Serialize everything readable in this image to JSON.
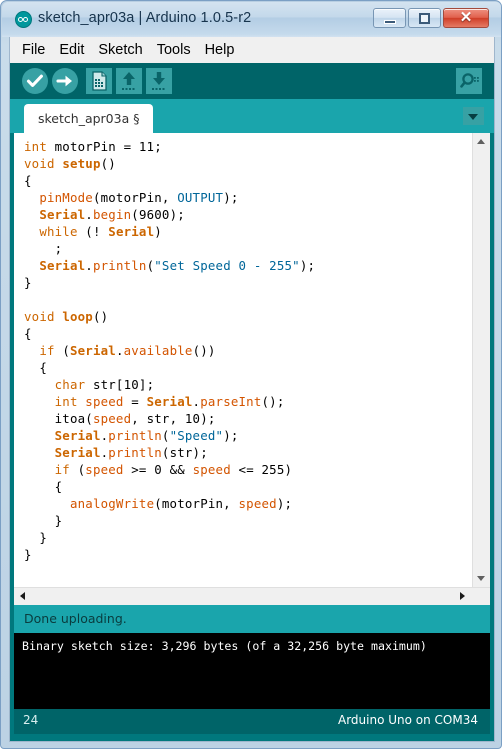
{
  "window": {
    "title": "sketch_apr03a | Arduino 1.0.5-r2",
    "logo_icon": "arduino-infinity-icon",
    "minimize_icon": "minimize-icon",
    "maximize_icon": "maximize-icon",
    "close_icon": "close-icon",
    "close_glyph": "✕"
  },
  "menu": {
    "items": [
      {
        "label": "File"
      },
      {
        "label": "Edit"
      },
      {
        "label": "Sketch"
      },
      {
        "label": "Tools"
      },
      {
        "label": "Help"
      }
    ]
  },
  "toolbar": {
    "verify": {
      "name": "verify-button",
      "icon": "checkmark-icon",
      "tooltip": "Verify"
    },
    "upload": {
      "name": "upload-button",
      "icon": "arrow-right-icon",
      "tooltip": "Upload"
    },
    "new": {
      "name": "new-button",
      "icon": "new-document-icon",
      "tooltip": "New"
    },
    "open": {
      "name": "open-button",
      "icon": "arrow-up-icon",
      "tooltip": "Open"
    },
    "save": {
      "name": "save-button",
      "icon": "arrow-down-icon",
      "tooltip": "Save"
    },
    "serial_monitor": {
      "name": "serial-monitor-button",
      "icon": "magnifier-icon",
      "tooltip": "Serial Monitor"
    }
  },
  "tabs": {
    "active": "sketch_apr03a §",
    "menu_icon": "chevron-down-icon"
  },
  "editor": {
    "code_lines": [
      [
        {
          "t": "int ",
          "c": "kw"
        },
        {
          "t": "motorPin = 11;",
          "c": "pl"
        }
      ],
      [
        {
          "t": "void ",
          "c": "kw"
        },
        {
          "t": "setup",
          "c": "bd"
        },
        {
          "t": "()",
          "c": "pl"
        }
      ],
      [
        {
          "t": "{",
          "c": "pl"
        }
      ],
      [
        {
          "t": "  ",
          "c": "pl"
        },
        {
          "t": "pinMode",
          "c": "fn"
        },
        {
          "t": "(motorPin, ",
          "c": "pl"
        },
        {
          "t": "OUTPUT",
          "c": "lit"
        },
        {
          "t": ");",
          "c": "pl"
        }
      ],
      [
        {
          "t": "  ",
          "c": "pl"
        },
        {
          "t": "Serial",
          "c": "bd"
        },
        {
          "t": ".",
          "c": "pl"
        },
        {
          "t": "begin",
          "c": "fn"
        },
        {
          "t": "(9600);",
          "c": "pl"
        }
      ],
      [
        {
          "t": "  ",
          "c": "pl"
        },
        {
          "t": "while",
          "c": "kw"
        },
        {
          "t": " (! ",
          "c": "pl"
        },
        {
          "t": "Serial",
          "c": "bd"
        },
        {
          "t": ")",
          "c": "pl"
        }
      ],
      [
        {
          "t": "    ;",
          "c": "pl"
        }
      ],
      [
        {
          "t": "  ",
          "c": "pl"
        },
        {
          "t": "Serial",
          "c": "bd"
        },
        {
          "t": ".",
          "c": "pl"
        },
        {
          "t": "println",
          "c": "fn"
        },
        {
          "t": "(",
          "c": "pl"
        },
        {
          "t": "\"Set Speed 0 - 255\"",
          "c": "lit"
        },
        {
          "t": ");",
          "c": "pl"
        }
      ],
      [
        {
          "t": "}",
          "c": "pl"
        }
      ],
      [
        {
          "t": "",
          "c": "pl"
        }
      ],
      [
        {
          "t": "void ",
          "c": "kw"
        },
        {
          "t": "loop",
          "c": "bd"
        },
        {
          "t": "()",
          "c": "pl"
        }
      ],
      [
        {
          "t": "{",
          "c": "pl"
        }
      ],
      [
        {
          "t": "  ",
          "c": "pl"
        },
        {
          "t": "if",
          "c": "kw"
        },
        {
          "t": " (",
          "c": "pl"
        },
        {
          "t": "Serial",
          "c": "bd"
        },
        {
          "t": ".",
          "c": "pl"
        },
        {
          "t": "available",
          "c": "fn"
        },
        {
          "t": "())",
          "c": "pl"
        }
      ],
      [
        {
          "t": "  {",
          "c": "pl"
        }
      ],
      [
        {
          "t": "    ",
          "c": "pl"
        },
        {
          "t": "char ",
          "c": "kw"
        },
        {
          "t": "str[10];",
          "c": "pl"
        }
      ],
      [
        {
          "t": "    ",
          "c": "pl"
        },
        {
          "t": "int ",
          "c": "kw"
        },
        {
          "t": "speed",
          "c": "fn"
        },
        {
          "t": " = ",
          "c": "pl"
        },
        {
          "t": "Serial",
          "c": "bd"
        },
        {
          "t": ".",
          "c": "pl"
        },
        {
          "t": "parseInt",
          "c": "fn"
        },
        {
          "t": "();",
          "c": "pl"
        }
      ],
      [
        {
          "t": "    itoa(",
          "c": "pl"
        },
        {
          "t": "speed",
          "c": "fn"
        },
        {
          "t": ", str, 10);",
          "c": "pl"
        }
      ],
      [
        {
          "t": "    ",
          "c": "pl"
        },
        {
          "t": "Serial",
          "c": "bd"
        },
        {
          "t": ".",
          "c": "pl"
        },
        {
          "t": "println",
          "c": "fn"
        },
        {
          "t": "(",
          "c": "pl"
        },
        {
          "t": "\"Speed\"",
          "c": "lit"
        },
        {
          "t": ");",
          "c": "pl"
        }
      ],
      [
        {
          "t": "    ",
          "c": "pl"
        },
        {
          "t": "Serial",
          "c": "bd"
        },
        {
          "t": ".",
          "c": "pl"
        },
        {
          "t": "println",
          "c": "fn"
        },
        {
          "t": "(str);",
          "c": "pl"
        }
      ],
      [
        {
          "t": "    ",
          "c": "pl"
        },
        {
          "t": "if",
          "c": "kw"
        },
        {
          "t": " (",
          "c": "pl"
        },
        {
          "t": "speed",
          "c": "fn"
        },
        {
          "t": " >= 0 && ",
          "c": "pl"
        },
        {
          "t": "speed",
          "c": "fn"
        },
        {
          "t": " <= 255)",
          "c": "pl"
        }
      ],
      [
        {
          "t": "    {",
          "c": "pl"
        }
      ],
      [
        {
          "t": "      ",
          "c": "pl"
        },
        {
          "t": "analogWrite",
          "c": "fn"
        },
        {
          "t": "(motorPin, ",
          "c": "pl"
        },
        {
          "t": "speed",
          "c": "fn"
        },
        {
          "t": ");",
          "c": "pl"
        }
      ],
      [
        {
          "t": "    }",
          "c": "pl"
        }
      ],
      [
        {
          "t": "  }",
          "c": "pl"
        }
      ],
      [
        {
          "t": "}",
          "c": "pl"
        }
      ]
    ]
  },
  "scrollbars": {
    "v_up_icon": "scroll-up-arrow-icon",
    "v_down_icon": "scroll-down-arrow-icon",
    "h_left_icon": "scroll-left-arrow-icon",
    "h_right_icon": "scroll-right-arrow-icon"
  },
  "status": {
    "message": "Done uploading.",
    "console": "Binary sketch size: 3,296 bytes (of a 32,256 byte maximum)",
    "line_number": "24",
    "board": "Arduino Uno on COM34"
  },
  "colors": {
    "teal_dark": "#006468",
    "teal_mid": "#00787d",
    "teal_light": "#1aa5ac",
    "icon_tile": "#37a1a4",
    "keyword": "#cc6600",
    "function": "#d35400",
    "literal": "#006699",
    "console_bg": "#000000",
    "frame": "#bcd2e4"
  }
}
